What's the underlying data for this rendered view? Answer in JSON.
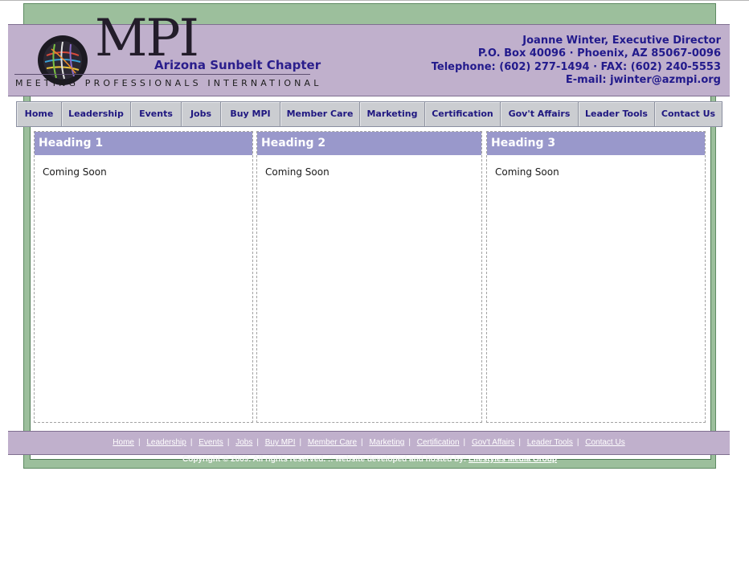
{
  "branding": {
    "logo_text": "MPI",
    "chapter": "Arizona Sunbelt Chapter",
    "tagline": "MEETING PROFESSIONALS INTERNATIONAL"
  },
  "contact": {
    "name_line": "Joanne Winter, Executive Director",
    "address_line": "P.O. Box 40096 · Phoenix, AZ 85067-0096",
    "phone_line": "Telephone: (602) 277-1494 · FAX: (602) 240-5553",
    "email_line": "E-mail: jwinter@azmpi.org"
  },
  "nav": {
    "items": [
      {
        "label": "Home"
      },
      {
        "label": "Leadership"
      },
      {
        "label": "Events"
      },
      {
        "label": "Jobs"
      },
      {
        "label": "Buy MPI"
      },
      {
        "label": "Member Care"
      },
      {
        "label": "Marketing"
      },
      {
        "label": "Certification"
      },
      {
        "label": "Gov't Affairs"
      },
      {
        "label": "Leader Tools"
      },
      {
        "label": "Contact Us"
      }
    ]
  },
  "columns": [
    {
      "heading": "Heading 1",
      "body": "Coming Soon"
    },
    {
      "heading": "Heading 2",
      "body": "Coming Soon"
    },
    {
      "heading": "Heading 3",
      "body": "Coming Soon"
    }
  ],
  "footer": {
    "links": [
      "Home",
      "Leadership",
      "Events",
      "Jobs",
      "Buy MPI",
      "Member Care",
      "Marketing",
      "Certification",
      "Gov't Affairs",
      "Leader Tools",
      "Contact Us"
    ],
    "separator": "|",
    "copyright_text": "Copyright © 2009. All rights reserved.  ::  website developed and hosted by:",
    "developer_link": "Lifestyles Media Group"
  },
  "colors": {
    "frame_green": "#9cbf9c",
    "header_purple": "#c0b0cc",
    "heading_blue": "#9998cb",
    "link_navy": "#221a8c"
  }
}
